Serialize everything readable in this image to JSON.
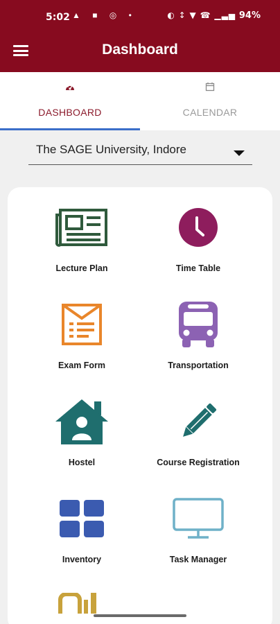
{
  "status": {
    "time": "5:02",
    "left_icons": "▲ ■ ◎ •",
    "right_icons": "◐ ↕ ▼ ☎ ▁▃▅",
    "battery": "94%"
  },
  "header": {
    "title": "Dashboard",
    "accent_color": "#870b1f"
  },
  "tabs": [
    {
      "label": "DASHBOARD",
      "icon": "dashboard-gauge-icon",
      "active": true
    },
    {
      "label": "CALENDAR",
      "icon": "calendar-icon",
      "active": false
    }
  ],
  "institution": {
    "selected": "The SAGE University, Indore"
  },
  "grid": [
    {
      "label": "Lecture Plan",
      "icon": "newspaper-icon",
      "color": "#2f5a3c"
    },
    {
      "label": "Time Table",
      "icon": "clock-icon",
      "color": "#8e1d5d"
    },
    {
      "label": "Exam Form",
      "icon": "form-envelope-icon",
      "color": "#e9862b"
    },
    {
      "label": "Transportation",
      "icon": "bus-icon",
      "color": "#8c62b3"
    },
    {
      "label": "Hostel",
      "icon": "house-user-icon",
      "color": "#1f6e6e"
    },
    {
      "label": "Course Registration",
      "icon": "pencil-icon",
      "color": "#1f6e6e"
    },
    {
      "label": "Inventory",
      "icon": "grid-icon",
      "color": "#3b5bb0"
    },
    {
      "label": "Task Manager",
      "icon": "monitor-icon",
      "color": "#6fb1c8"
    }
  ]
}
